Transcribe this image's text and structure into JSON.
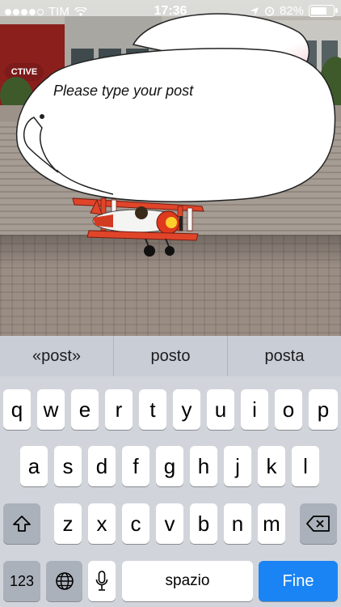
{
  "status": {
    "carrier": "TIM",
    "time": "17:36",
    "battery": "82%",
    "battery_level": 0.82
  },
  "post": {
    "placeholder": "Please type your post"
  },
  "scene": {
    "sign_text": "CTIVE"
  },
  "suggestions": [
    "«post»",
    "posto",
    "posta"
  ],
  "keyboard": {
    "row1": [
      "q",
      "w",
      "e",
      "r",
      "t",
      "y",
      "u",
      "i",
      "o",
      "p"
    ],
    "row2": [
      "a",
      "s",
      "d",
      "f",
      "g",
      "h",
      "j",
      "k",
      "l"
    ],
    "row3": [
      "z",
      "x",
      "c",
      "v",
      "b",
      "n",
      "m"
    ],
    "numbers_label": "123",
    "space_label": "spazio",
    "return_label": "Fine"
  },
  "icons": {
    "shift": "shift-icon",
    "backspace": "backspace-icon",
    "globe": "globe-icon",
    "mic": "microphone-icon",
    "wifi": "wifi-icon",
    "location": "location-icon",
    "alarm": "alarm-icon"
  },
  "colors": {
    "return_key": "#1a84f5",
    "keyboard_bg": "#d1d5db"
  }
}
